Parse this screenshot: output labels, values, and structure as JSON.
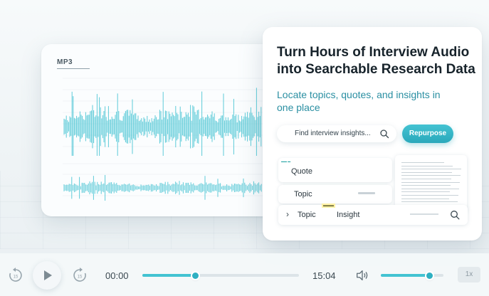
{
  "file_card": {
    "label": "MP3"
  },
  "panel": {
    "headline": "Turn Hours of Interview Audio into Searchable Research Data",
    "subheadline": "Locate topics, quotes, and insights in one place",
    "search": {
      "placeholder": "Find interview insights..."
    },
    "repurpose_label": "Repurpose",
    "quote_label": "Quote",
    "topic_label": "Topic",
    "row_topic_label": "Topic",
    "row_insight_label": "Insight"
  },
  "player": {
    "current_time": "00:00",
    "duration": "15:04",
    "progress": 0.34,
    "volume": 0.78,
    "speed": "1x"
  },
  "colors": {
    "accent": "#43c3d2",
    "accent_dark": "#2aa9bb",
    "headline": "#17232b",
    "sub": "#2a8fa2"
  }
}
